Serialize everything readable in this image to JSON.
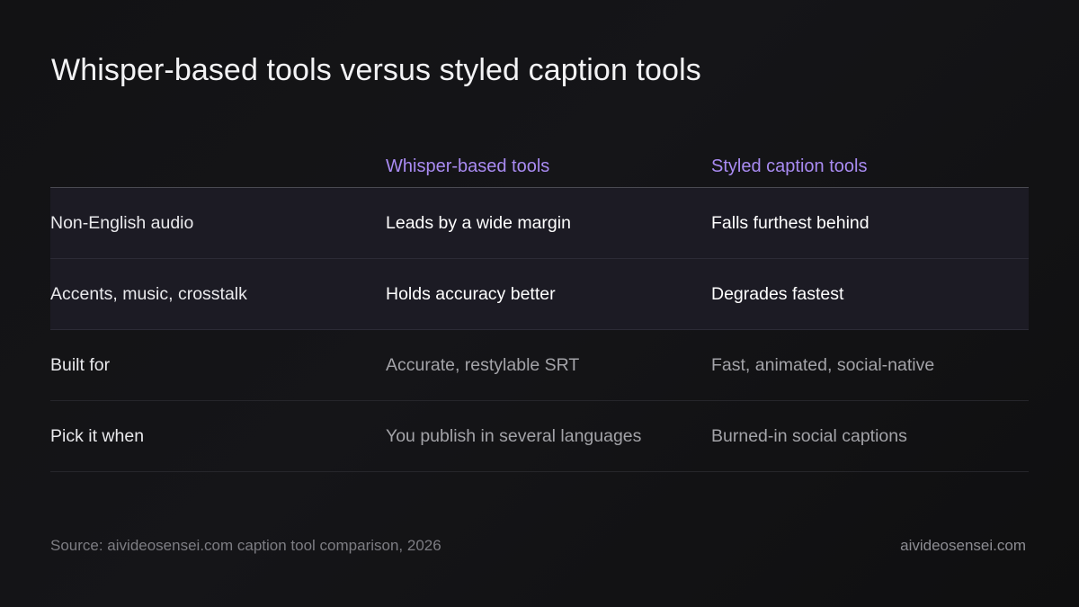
{
  "title": "Whisper-based tools versus styled caption tools",
  "table": {
    "headers": [
      "",
      "Whisper-based tools",
      "Styled caption tools"
    ],
    "rows": [
      {
        "label": "Non-English audio",
        "whisper": "Leads by a wide margin",
        "styled": "Falls furthest behind",
        "highlighted": true
      },
      {
        "label": "Accents, music, crosstalk",
        "whisper": "Holds accuracy better",
        "styled": "Degrades fastest",
        "highlighted": true
      },
      {
        "label": "Built for",
        "whisper": "Accurate, restylable SRT",
        "styled": "Fast, animated, social-native",
        "highlighted": false
      },
      {
        "label": "Pick it when",
        "whisper": "You publish in several languages",
        "styled": "Burned-in social captions",
        "highlighted": false
      }
    ]
  },
  "footer": {
    "source": "Source: aivideosensei.com caption tool comparison, 2026",
    "site": "aivideosensei.com"
  },
  "colors": {
    "accent": "#a98bf2",
    "background": "#131315",
    "highlight_row": "#1c1b24"
  }
}
